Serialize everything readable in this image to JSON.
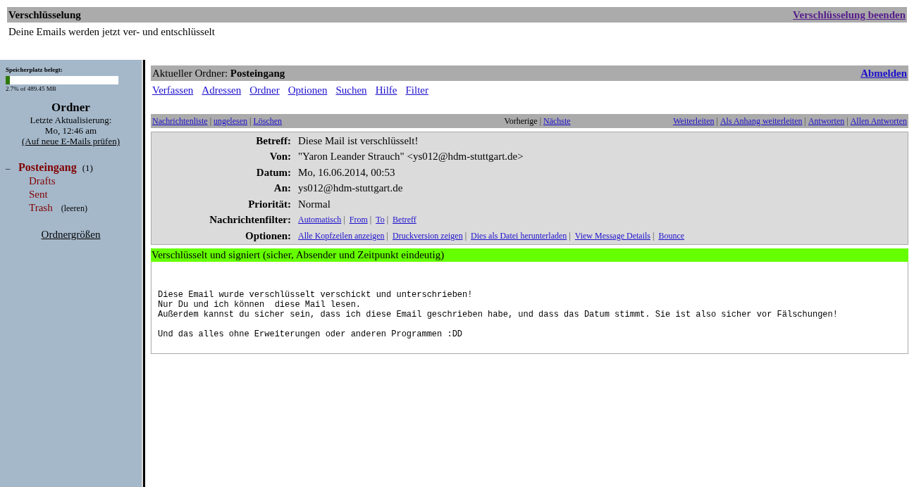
{
  "banner": {
    "title": "Verschlüsselung",
    "action": "Verschlüsselung beenden",
    "message": "Deine Emails werden jetzt ver- und entschlüsselt"
  },
  "sidebar": {
    "storage": {
      "label": "Speicherplatz belegt:",
      "level": 0.027,
      "reading": "2.7% of 489.45 MB"
    },
    "title": "Ordner",
    "updated_label": "Letzte Aktualisierung:",
    "updated_time": "Mo, 12:46 am",
    "check_link": "(Auf neue E-Mails prüfen)",
    "folders": [
      {
        "name": "Posteingang",
        "count": "(1)",
        "toggle": "–",
        "expanded": true,
        "unread": true,
        "children": [
          {
            "name": "Drafts",
            "unread": false
          },
          {
            "name": "Sent",
            "unread": false
          },
          {
            "name": "Trash",
            "unread": false,
            "action": "(leeren)"
          }
        ]
      }
    ],
    "sizes_link": "Ordnergrößen"
  },
  "header": {
    "label": "Aktueller Ordner:",
    "folder": "Posteingang",
    "logout": "Abmelden"
  },
  "menu": [
    "Verfassen",
    "Adressen",
    "Ordner",
    "Optionen",
    "Suchen",
    "Hilfe",
    "Filter"
  ],
  "toolbar": {
    "separator": "|",
    "left": [
      {
        "label": "Nachrichtenliste",
        "link": true
      },
      {
        "label": "ungelesen",
        "link": true
      },
      {
        "label": "Löschen",
        "link": true
      }
    ],
    "center": [
      {
        "label": "Vorherige",
        "link": false
      },
      {
        "label": "Nächste",
        "link": true
      }
    ],
    "right": [
      {
        "label": "Weiterleiten",
        "link": true
      },
      {
        "label": "Als Anhang weiterleiten",
        "link": true
      },
      {
        "label": "Antworten",
        "link": true
      },
      {
        "label": "Allen Antworten",
        "link": true
      }
    ]
  },
  "headers": [
    {
      "label": "Betreff:",
      "kind": "text",
      "value": "Diese Mail ist verschlüsselt!"
    },
    {
      "label": "Von:",
      "kind": "text",
      "value": "\"Yaron Leander Strauch\" <ys012@hdm-stuttgart.de>"
    },
    {
      "label": "Datum:",
      "kind": "text",
      "value": "Mo, 16.06.2014, 00:53"
    },
    {
      "label": "An:",
      "kind": "text",
      "value": "ys012@hdm-stuttgart.de"
    },
    {
      "label": "Priorität:",
      "kind": "text",
      "value": "Normal"
    },
    {
      "label": "Nachrichtenfilter:",
      "kind": "links",
      "links": [
        "Automatisch",
        "From",
        "To",
        "Betreff"
      ]
    },
    {
      "label": "Optionen:",
      "kind": "links",
      "links": [
        "Alle Kopfzeilen anzeigen",
        "Druckversion zeigen",
        "Dies als Datei herunterladen",
        "View Message Details",
        "Bounce"
      ]
    }
  ],
  "status": {
    "text": "Verschlüsselt und signiert (sicher, Absender und Zeitpunkt eindeutig)",
    "color": "#66ff00"
  },
  "body": [
    [
      "Diese Email wurde verschlüsselt verschickt und unterschrieben!",
      "Nur Du und ich können  diese Mail lesen.",
      "Außerdem kannst du sicher sein, dass ich diese Email geschrieben habe, und dass das Datum stimmt. Sie ist also sicher vor Fälschungen!"
    ],
    [
      "Und das alles ohne Erweiterungen oder anderen Programmen :DD"
    ]
  ]
}
